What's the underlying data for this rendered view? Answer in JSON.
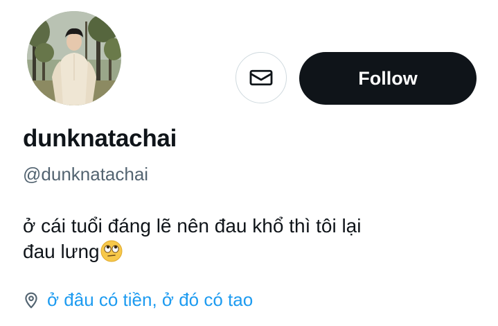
{
  "profile": {
    "display_name": "dunknatachai",
    "handle": "@dunknatachai",
    "bio_line1": "ở cái tuổi đáng lẽ nên đau khổ thì tôi lại",
    "bio_line2": "đau lưng",
    "bio_emoji": "face-with-rolling-eyes-emoji",
    "location": "ở đâu có tiền, ở đó có tao"
  },
  "actions": {
    "message_icon": "envelope-icon",
    "follow_label": "Follow"
  },
  "icons": {
    "location": "location-pin-icon"
  },
  "colors": {
    "primary_text": "#0f1419",
    "secondary_text": "#536471",
    "link": "#1d9bf0",
    "follow_bg": "#0f1419",
    "border": "#cfd9de"
  }
}
